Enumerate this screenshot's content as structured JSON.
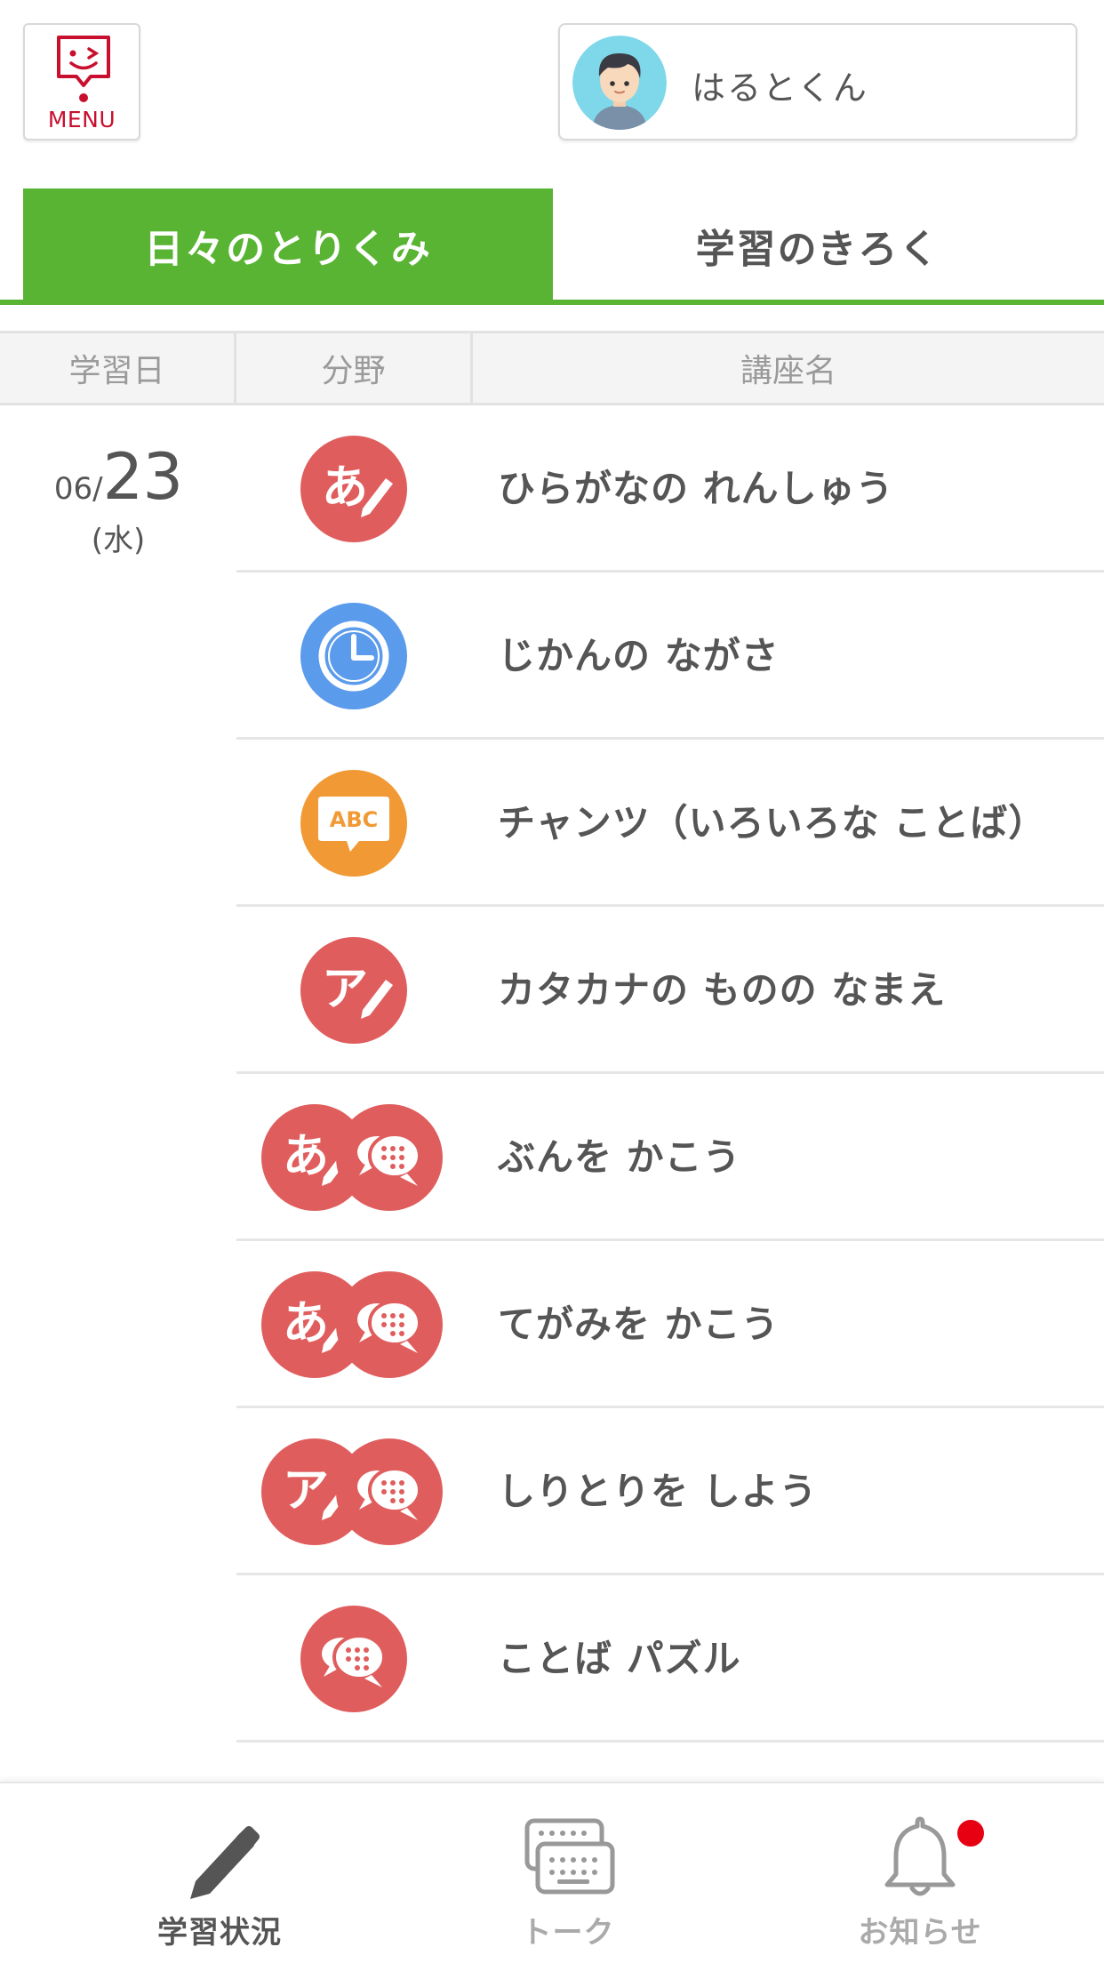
{
  "header": {
    "menu_label": "MENU",
    "user_name": "はるとくん"
  },
  "tabs": [
    {
      "label": "日々のとりくみ",
      "active": true
    },
    {
      "label": "学習のきろく",
      "active": false
    }
  ],
  "table": {
    "headers": {
      "date": "学習日",
      "field": "分野",
      "course": "講座名"
    },
    "date": {
      "month": "06",
      "separator": "/",
      "day": "23",
      "weekday": "(水)"
    },
    "rows": [
      {
        "course": "ひらがなの れんしゅう",
        "icons": [
          "hiragana-pencil-icon"
        ]
      },
      {
        "course": "じかんの ながさ",
        "icons": [
          "clock-icon"
        ]
      },
      {
        "course": "チャンツ（いろいろな ことば）",
        "icons": [
          "abc-speech-icon"
        ]
      },
      {
        "course": "カタカナの ものの なまえ",
        "icons": [
          "katakana-pencil-icon"
        ]
      },
      {
        "course": "ぶんを かこう",
        "icons": [
          "hiragana-pencil-icon",
          "speech-bubble-icon"
        ]
      },
      {
        "course": "てがみを かこう",
        "icons": [
          "hiragana-pencil-icon",
          "speech-bubble-icon"
        ]
      },
      {
        "course": "しりとりを しよう",
        "icons": [
          "katakana-pencil-icon",
          "speech-bubble-icon"
        ]
      },
      {
        "course": "ことば パズル",
        "icons": [
          "speech-bubble-icon"
        ]
      }
    ]
  },
  "bottom_nav": [
    {
      "label": "学習状況",
      "icon": "pencil-icon",
      "active": true
    },
    {
      "label": "トーク",
      "icon": "chat-keyboard-icon",
      "active": false
    },
    {
      "label": "お知らせ",
      "icon": "bell-icon",
      "active": false,
      "badge": true
    }
  ],
  "colors": {
    "accent_green": "#5ab434",
    "japanese_red": "#e05d5d",
    "math_blue": "#5b9bec",
    "english_orange": "#f19a35",
    "badge_red": "#e60012"
  }
}
